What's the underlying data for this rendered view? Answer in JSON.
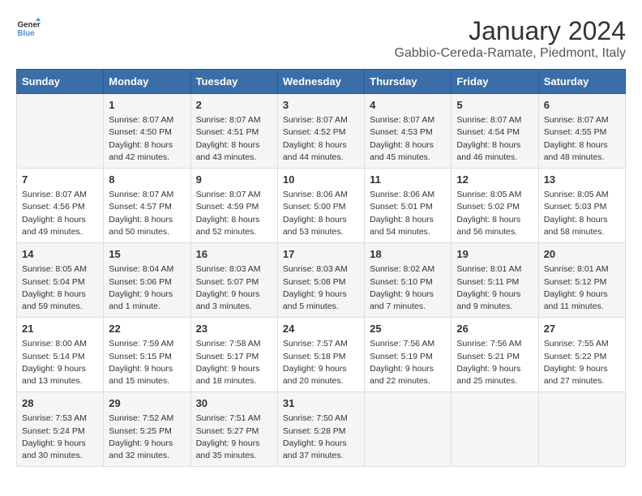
{
  "logo": {
    "line1": "General",
    "line2": "Blue"
  },
  "title": "January 2024",
  "subtitle": "Gabbio-Cereda-Ramate, Piedmont, Italy",
  "days_of_week": [
    "Sunday",
    "Monday",
    "Tuesday",
    "Wednesday",
    "Thursday",
    "Friday",
    "Saturday"
  ],
  "weeks": [
    [
      {
        "day": "",
        "info": ""
      },
      {
        "day": "1",
        "info": "Sunrise: 8:07 AM\nSunset: 4:50 PM\nDaylight: 8 hours\nand 42 minutes."
      },
      {
        "day": "2",
        "info": "Sunrise: 8:07 AM\nSunset: 4:51 PM\nDaylight: 8 hours\nand 43 minutes."
      },
      {
        "day": "3",
        "info": "Sunrise: 8:07 AM\nSunset: 4:52 PM\nDaylight: 8 hours\nand 44 minutes."
      },
      {
        "day": "4",
        "info": "Sunrise: 8:07 AM\nSunset: 4:53 PM\nDaylight: 8 hours\nand 45 minutes."
      },
      {
        "day": "5",
        "info": "Sunrise: 8:07 AM\nSunset: 4:54 PM\nDaylight: 8 hours\nand 46 minutes."
      },
      {
        "day": "6",
        "info": "Sunrise: 8:07 AM\nSunset: 4:55 PM\nDaylight: 8 hours\nand 48 minutes."
      }
    ],
    [
      {
        "day": "7",
        "info": "Sunrise: 8:07 AM\nSunset: 4:56 PM\nDaylight: 8 hours\nand 49 minutes."
      },
      {
        "day": "8",
        "info": "Sunrise: 8:07 AM\nSunset: 4:57 PM\nDaylight: 8 hours\nand 50 minutes."
      },
      {
        "day": "9",
        "info": "Sunrise: 8:07 AM\nSunset: 4:59 PM\nDaylight: 8 hours\nand 52 minutes."
      },
      {
        "day": "10",
        "info": "Sunrise: 8:06 AM\nSunset: 5:00 PM\nDaylight: 8 hours\nand 53 minutes."
      },
      {
        "day": "11",
        "info": "Sunrise: 8:06 AM\nSunset: 5:01 PM\nDaylight: 8 hours\nand 54 minutes."
      },
      {
        "day": "12",
        "info": "Sunrise: 8:05 AM\nSunset: 5:02 PM\nDaylight: 8 hours\nand 56 minutes."
      },
      {
        "day": "13",
        "info": "Sunrise: 8:05 AM\nSunset: 5:03 PM\nDaylight: 8 hours\nand 58 minutes."
      }
    ],
    [
      {
        "day": "14",
        "info": "Sunrise: 8:05 AM\nSunset: 5:04 PM\nDaylight: 8 hours\nand 59 minutes."
      },
      {
        "day": "15",
        "info": "Sunrise: 8:04 AM\nSunset: 5:06 PM\nDaylight: 9 hours\nand 1 minute."
      },
      {
        "day": "16",
        "info": "Sunrise: 8:03 AM\nSunset: 5:07 PM\nDaylight: 9 hours\nand 3 minutes."
      },
      {
        "day": "17",
        "info": "Sunrise: 8:03 AM\nSunset: 5:08 PM\nDaylight: 9 hours\nand 5 minutes."
      },
      {
        "day": "18",
        "info": "Sunrise: 8:02 AM\nSunset: 5:10 PM\nDaylight: 9 hours\nand 7 minutes."
      },
      {
        "day": "19",
        "info": "Sunrise: 8:01 AM\nSunset: 5:11 PM\nDaylight: 9 hours\nand 9 minutes."
      },
      {
        "day": "20",
        "info": "Sunrise: 8:01 AM\nSunset: 5:12 PM\nDaylight: 9 hours\nand 11 minutes."
      }
    ],
    [
      {
        "day": "21",
        "info": "Sunrise: 8:00 AM\nSunset: 5:14 PM\nDaylight: 9 hours\nand 13 minutes."
      },
      {
        "day": "22",
        "info": "Sunrise: 7:59 AM\nSunset: 5:15 PM\nDaylight: 9 hours\nand 15 minutes."
      },
      {
        "day": "23",
        "info": "Sunrise: 7:58 AM\nSunset: 5:17 PM\nDaylight: 9 hours\nand 18 minutes."
      },
      {
        "day": "24",
        "info": "Sunrise: 7:57 AM\nSunset: 5:18 PM\nDaylight: 9 hours\nand 20 minutes."
      },
      {
        "day": "25",
        "info": "Sunrise: 7:56 AM\nSunset: 5:19 PM\nDaylight: 9 hours\nand 22 minutes."
      },
      {
        "day": "26",
        "info": "Sunrise: 7:56 AM\nSunset: 5:21 PM\nDaylight: 9 hours\nand 25 minutes."
      },
      {
        "day": "27",
        "info": "Sunrise: 7:55 AM\nSunset: 5:22 PM\nDaylight: 9 hours\nand 27 minutes."
      }
    ],
    [
      {
        "day": "28",
        "info": "Sunrise: 7:53 AM\nSunset: 5:24 PM\nDaylight: 9 hours\nand 30 minutes."
      },
      {
        "day": "29",
        "info": "Sunrise: 7:52 AM\nSunset: 5:25 PM\nDaylight: 9 hours\nand 32 minutes."
      },
      {
        "day": "30",
        "info": "Sunrise: 7:51 AM\nSunset: 5:27 PM\nDaylight: 9 hours\nand 35 minutes."
      },
      {
        "day": "31",
        "info": "Sunrise: 7:50 AM\nSunset: 5:28 PM\nDaylight: 9 hours\nand 37 minutes."
      },
      {
        "day": "",
        "info": ""
      },
      {
        "day": "",
        "info": ""
      },
      {
        "day": "",
        "info": ""
      }
    ]
  ]
}
